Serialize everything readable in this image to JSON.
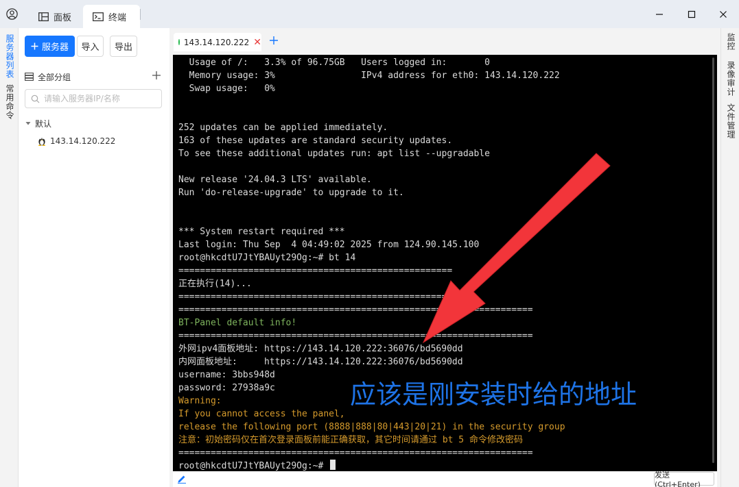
{
  "titlebar": {
    "tabs": [
      {
        "label": "面板",
        "icon": "dashboard-icon"
      },
      {
        "label": "终端",
        "icon": "terminal-icon"
      }
    ]
  },
  "leftstrip": {
    "items": [
      "服务器列表",
      "常用命令"
    ]
  },
  "sidebar": {
    "add_server_label": "服务器",
    "import_label": "导入",
    "export_label": "导出",
    "group_label": "全部分组",
    "search_placeholder": "请输入服务器IP/名称",
    "tree_default": "默认",
    "tree_server": "143.14.120.222"
  },
  "rightstrip": {
    "items": [
      "监控",
      "录像审计",
      "文件管理"
    ]
  },
  "terminal_tab": {
    "label": "143.14.120.222"
  },
  "terminal": {
    "lines": [
      {
        "text": "  Usage of /:   3.3% of 96.75GB   Users logged in:       0",
        "style": "normal"
      },
      {
        "text": "  Memory usage: 3%                IPv4 address for eth0: 143.14.120.222",
        "style": "normal"
      },
      {
        "text": "  Swap usage:   0%",
        "style": "normal"
      },
      {
        "text": "",
        "style": "normal"
      },
      {
        "text": "",
        "style": "normal"
      },
      {
        "text": "252 updates can be applied immediately.",
        "style": "normal"
      },
      {
        "text": "163 of these updates are standard security updates.",
        "style": "normal"
      },
      {
        "text": "To see these additional updates run: apt list --upgradable",
        "style": "normal"
      },
      {
        "text": "",
        "style": "normal"
      },
      {
        "text": "New release '24.04.3 LTS' available.",
        "style": "normal"
      },
      {
        "text": "Run 'do-release-upgrade' to upgrade to it.",
        "style": "normal"
      },
      {
        "text": "",
        "style": "normal"
      },
      {
        "text": "",
        "style": "normal"
      },
      {
        "text": "*** System restart required ***",
        "style": "normal"
      },
      {
        "text": "Last login: Thu Sep  4 04:49:02 2025 from 124.90.145.100",
        "style": "normal"
      },
      {
        "text": "root@hkcdtU7JtYBAUyt29Og:~# bt 14",
        "style": "normal"
      },
      {
        "text": "===================================================",
        "style": "normal"
      },
      {
        "text": "正在执行(14)...",
        "style": "normal"
      },
      {
        "text": "===================================================",
        "style": "normal"
      },
      {
        "text": "==================================================================",
        "style": "normal"
      },
      {
        "text": "BT-Panel default info!",
        "style": "green"
      },
      {
        "text": "==================================================================",
        "style": "normal"
      },
      {
        "text": "外网ipv4面板地址: https://143.14.120.222:36076/bd5690dd",
        "style": "normal"
      },
      {
        "text": "内网面板地址:     https://143.14.120.222:36076/bd5690dd",
        "style": "normal"
      },
      {
        "text": "username: 3bbs948d",
        "style": "normal"
      },
      {
        "text": "password: 27938a9c",
        "style": "normal"
      },
      {
        "text": "Warning:",
        "style": "orange"
      },
      {
        "text": "If you cannot access the panel,",
        "style": "orange"
      },
      {
        "text": "release the following port (8888|888|80|443|20|21) in the security group",
        "style": "orange"
      },
      {
        "text": "注意：初始密码仅在首次登录面板前能正确获取，其它时间请通过 bt 5 命令修改密码",
        "style": "orange"
      },
      {
        "text": "==================================================================",
        "style": "normal"
      },
      {
        "text": "root@hkcdtU7JtYBAUyt29Og:~# ",
        "style": "prompt"
      }
    ]
  },
  "annotation": {
    "text": "应该是刚安装时给的地址",
    "arrow_color": "#f2353a",
    "text_color": "#1e73e6"
  },
  "bottombar": {
    "send_label": "发送(Ctrl+Enter)"
  },
  "colors": {
    "accent": "#1677ff",
    "terminal_bg": "#000000",
    "status_online": "#20b84a",
    "warning": "#d69b2c",
    "info_green": "#7fb55e"
  }
}
